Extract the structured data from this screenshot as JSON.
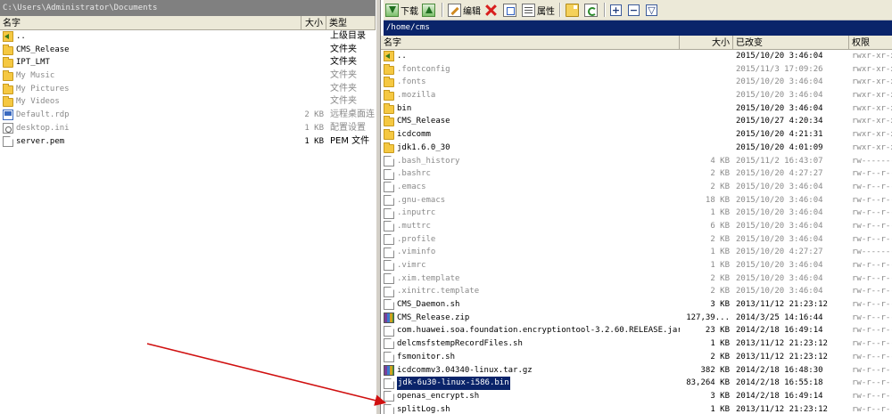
{
  "left": {
    "path": "C:\\Users\\Administrator\\Documents",
    "columns": {
      "name": "名字",
      "size": "大小",
      "type": "类型"
    },
    "rows": [
      {
        "icon": "updir",
        "name": "..",
        "size": "",
        "type": "上级目录",
        "dim": false
      },
      {
        "icon": "folder",
        "name": "CMS_Release",
        "size": "",
        "type": "文件夹",
        "dim": false
      },
      {
        "icon": "folder",
        "name": "IPT_LMT",
        "size": "",
        "type": "文件夹",
        "dim": false
      },
      {
        "icon": "folder",
        "name": "My Music",
        "size": "",
        "type": "文件夹",
        "dim": true
      },
      {
        "icon": "folder",
        "name": "My Pictures",
        "size": "",
        "type": "文件夹",
        "dim": true
      },
      {
        "icon": "folder",
        "name": "My Videos",
        "size": "",
        "type": "文件夹",
        "dim": true
      },
      {
        "icon": "rdp",
        "name": "Default.rdp",
        "size": "2 KB",
        "type": "远程桌面连",
        "dim": true
      },
      {
        "icon": "ini",
        "name": "desktop.ini",
        "size": "1 KB",
        "type": "配置设置",
        "dim": true
      },
      {
        "icon": "file",
        "name": "server.pem",
        "size": "1 KB",
        "type": "PEM 文件",
        "dim": false
      }
    ]
  },
  "toolbar": {
    "download_label": "下载",
    "edit_label": "编辑",
    "properties_label": "属性",
    "expand_symbol": "+",
    "collapse_symbol": "−",
    "filter_symbol": "▽"
  },
  "right": {
    "path": "/home/cms",
    "columns": {
      "name": "名字",
      "size": "大小",
      "modified": "已改变",
      "perms": "权限"
    },
    "rows": [
      {
        "icon": "updir",
        "name": "..",
        "size": "",
        "modified": "2015/10/20 3:46:04",
        "perms": "rwxr-xr-x",
        "dim": false,
        "selected": false
      },
      {
        "icon": "folder",
        "name": ".fontconfig",
        "size": "",
        "modified": "2015/11/3 17:09:26",
        "perms": "rwxr-xr-x",
        "dim": true,
        "selected": false
      },
      {
        "icon": "folder",
        "name": ".fonts",
        "size": "",
        "modified": "2015/10/20 3:46:04",
        "perms": "rwxr-xr-x",
        "dim": true,
        "selected": false
      },
      {
        "icon": "folder",
        "name": ".mozilla",
        "size": "",
        "modified": "2015/10/20 3:46:04",
        "perms": "rwxr-xr-x",
        "dim": true,
        "selected": false
      },
      {
        "icon": "folder",
        "name": "bin",
        "size": "",
        "modified": "2015/10/20 3:46:04",
        "perms": "rwxr-xr-x",
        "dim": false,
        "selected": false
      },
      {
        "icon": "folder",
        "name": "CMS_Release",
        "size": "",
        "modified": "2015/10/27 4:20:34",
        "perms": "rwxr-xr-x",
        "dim": false,
        "selected": false
      },
      {
        "icon": "folder",
        "name": "icdcomm",
        "size": "",
        "modified": "2015/10/20 4:21:31",
        "perms": "rwxr-xr-x",
        "dim": false,
        "selected": false
      },
      {
        "icon": "folder",
        "name": "jdk1.6.0_30",
        "size": "",
        "modified": "2015/10/20 4:01:09",
        "perms": "rwxr-xr-x",
        "dim": false,
        "selected": false
      },
      {
        "icon": "file",
        "name": ".bash_history",
        "size": "4 KB",
        "modified": "2015/11/2 16:43:07",
        "perms": "rw-------",
        "dim": true,
        "selected": false
      },
      {
        "icon": "file",
        "name": ".bashrc",
        "size": "2 KB",
        "modified": "2015/10/20 4:27:27",
        "perms": "rw-r--r--",
        "dim": true,
        "selected": false
      },
      {
        "icon": "file",
        "name": ".emacs",
        "size": "2 KB",
        "modified": "2015/10/20 3:46:04",
        "perms": "rw-r--r--",
        "dim": true,
        "selected": false
      },
      {
        "icon": "file",
        "name": ".gnu-emacs",
        "size": "18 KB",
        "modified": "2015/10/20 3:46:04",
        "perms": "rw-r--r--",
        "dim": true,
        "selected": false
      },
      {
        "icon": "file",
        "name": ".inputrc",
        "size": "1 KB",
        "modified": "2015/10/20 3:46:04",
        "perms": "rw-r--r--",
        "dim": true,
        "selected": false
      },
      {
        "icon": "file",
        "name": ".muttrc",
        "size": "6 KB",
        "modified": "2015/10/20 3:46:04",
        "perms": "rw-r--r--",
        "dim": true,
        "selected": false
      },
      {
        "icon": "file",
        "name": ".profile",
        "size": "2 KB",
        "modified": "2015/10/20 3:46:04",
        "perms": "rw-r--r--",
        "dim": true,
        "selected": false
      },
      {
        "icon": "file",
        "name": ".viminfo",
        "size": "1 KB",
        "modified": "2015/10/20 4:27:27",
        "perms": "rw-------",
        "dim": true,
        "selected": false
      },
      {
        "icon": "file",
        "name": ".vimrc",
        "size": "1 KB",
        "modified": "2015/10/20 3:46:04",
        "perms": "rw-r--r--",
        "dim": true,
        "selected": false
      },
      {
        "icon": "file",
        "name": ".xim.template",
        "size": "2 KB",
        "modified": "2015/10/20 3:46:04",
        "perms": "rw-r--r--",
        "dim": true,
        "selected": false
      },
      {
        "icon": "file",
        "name": ".xinitrc.template",
        "size": "2 KB",
        "modified": "2015/10/20 3:46:04",
        "perms": "rw-r--r--",
        "dim": true,
        "selected": false
      },
      {
        "icon": "file",
        "name": "CMS_Daemon.sh",
        "size": "3 KB",
        "modified": "2013/11/12 21:23:12",
        "perms": "rw-r--r--",
        "dim": false,
        "selected": false
      },
      {
        "icon": "archive",
        "name": "CMS_Release.zip",
        "size": "127,39...",
        "modified": "2014/3/25 14:16:44",
        "perms": "rw-r--r--",
        "dim": false,
        "selected": false
      },
      {
        "icon": "file",
        "name": "com.huawei.soa.foundation.encryptiontool-3.2.60.RELEASE.jar",
        "size": "23 KB",
        "modified": "2014/2/18 16:49:14",
        "perms": "rw-r--r--",
        "dim": false,
        "selected": false
      },
      {
        "icon": "file",
        "name": "delcmsfstempRecordFiles.sh",
        "size": "1 KB",
        "modified": "2013/11/12 21:23:12",
        "perms": "rw-r--r--",
        "dim": false,
        "selected": false
      },
      {
        "icon": "file",
        "name": "fsmonitor.sh",
        "size": "2 KB",
        "modified": "2013/11/12 21:23:12",
        "perms": "rw-r--r--",
        "dim": false,
        "selected": false
      },
      {
        "icon": "archive",
        "name": "icdcommv3.04340-linux.tar.gz",
        "size": "382 KB",
        "modified": "2014/2/18 16:48:30",
        "perms": "rw-r--r--",
        "dim": false,
        "selected": false
      },
      {
        "icon": "file",
        "name": "jdk-6u30-linux-i586.bin",
        "size": "83,264 KB",
        "modified": "2014/2/18 16:55:18",
        "perms": "rw-r--r--",
        "dim": false,
        "selected": true
      },
      {
        "icon": "file",
        "name": "openas_encrypt.sh",
        "size": "3 KB",
        "modified": "2014/2/18 16:49:14",
        "perms": "rw-r--r--",
        "dim": false,
        "selected": false
      },
      {
        "icon": "file",
        "name": "splitLog.sh",
        "size": "1 KB",
        "modified": "2013/11/12 21:23:12",
        "perms": "rw-r--r--",
        "dim": false,
        "selected": false
      }
    ]
  },
  "colors": {
    "selection": "#0a246a",
    "annotation_arrow": "#d01010",
    "dim_text": "#8a8a8a"
  }
}
